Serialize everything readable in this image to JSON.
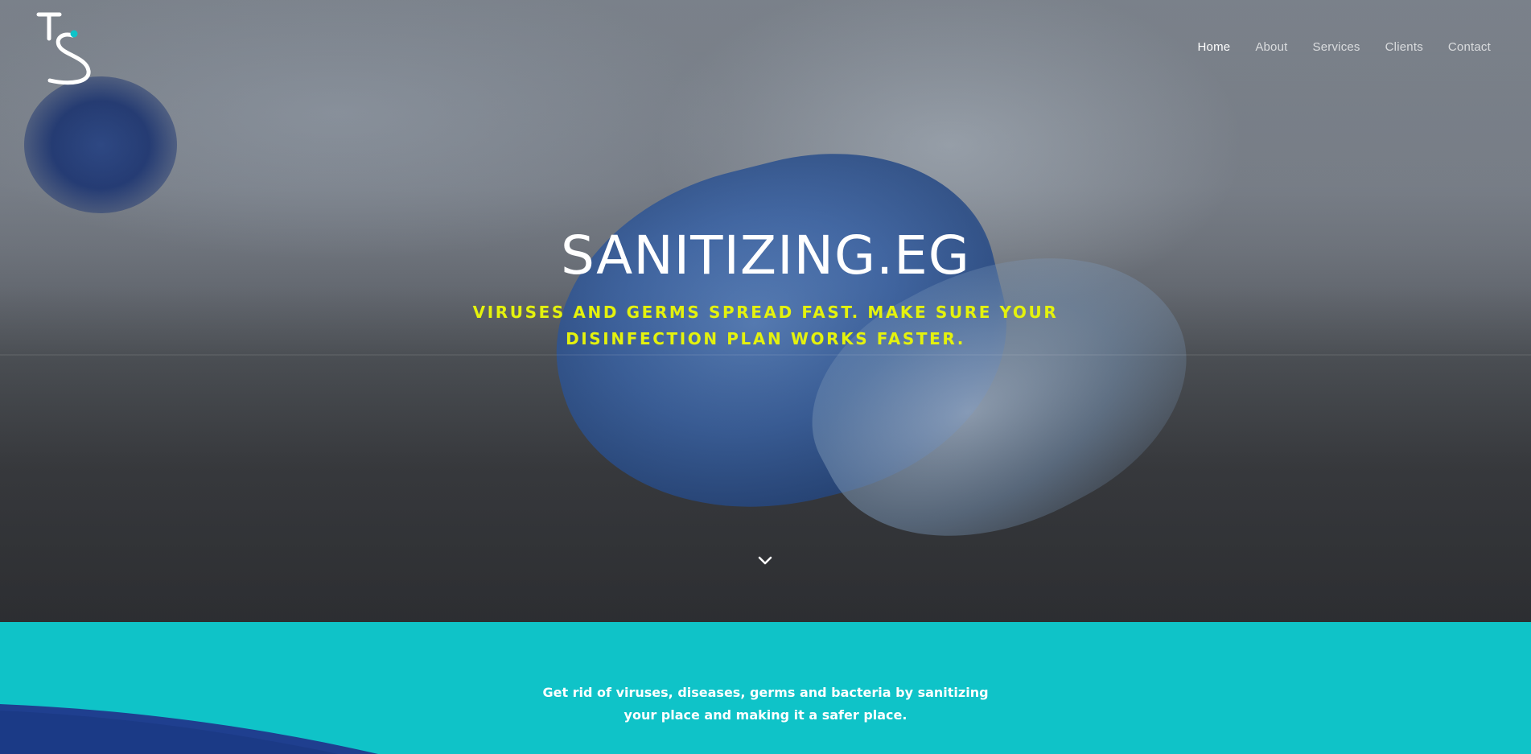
{
  "brand": {
    "logo_icon": "ts-monogram-logo",
    "accent_color": "#0fc3c8",
    "highlight_color": "#e4f20d"
  },
  "nav": {
    "items": [
      {
        "label": "Home"
      },
      {
        "label": "About"
      },
      {
        "label": "Services"
      },
      {
        "label": "Clients"
      },
      {
        "label": "Contact"
      }
    ]
  },
  "hero": {
    "title": "SANITIZING.EG",
    "subtitle_line1": "VIRUSES AND GERMS SPREAD FAST. MAKE SURE YOUR",
    "subtitle_line2": "DISINFECTION PLAN WORKS FASTER.",
    "scroll_icon": "chevron-down-icon"
  },
  "intro": {
    "line1": "Get rid of viruses, diseases, germs and bacteria by sanitizing",
    "line2": "your place and making it a safer place."
  }
}
